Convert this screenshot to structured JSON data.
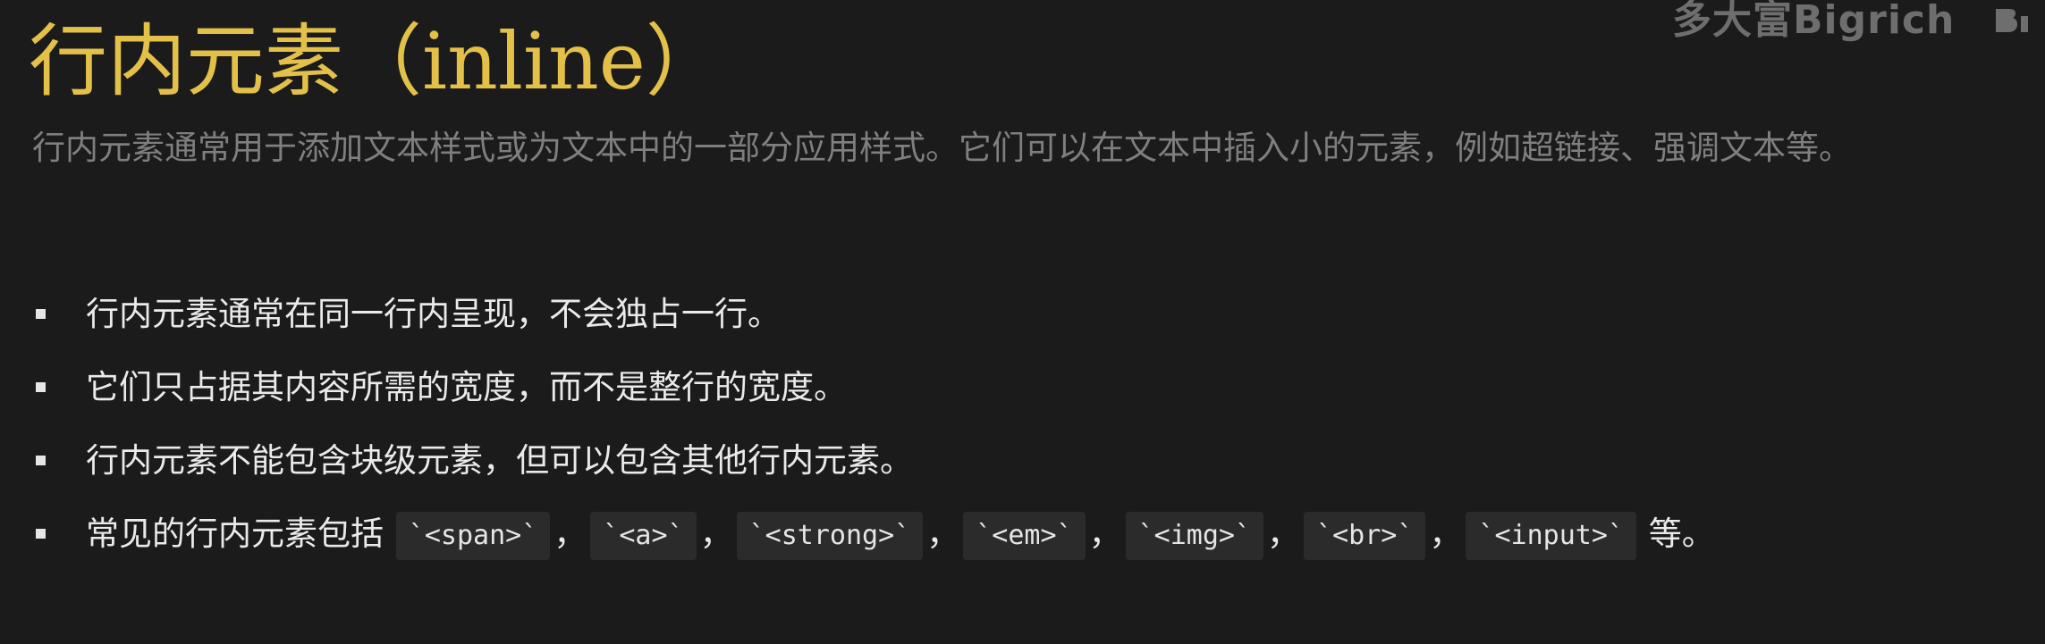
{
  "watermark": {
    "text": "多大富Bigrich",
    "logo_icon": "bilibili-logo-icon"
  },
  "slide": {
    "title": "行内元素（inline）",
    "intro": "行内元素通常用于添加文本样式或为文本中的一部分应用样式。它们可以在文本中插入小的元素，例如超链接、强调文本等。",
    "bullets": [
      "行内元素通常在同一行内呈现，不会独占一行。",
      "它们只占据其内容所需的宽度，而不是整行的宽度。",
      "行内元素不能包含块级元素，但可以包含其他行内元素。"
    ],
    "last_bullet": {
      "prefix": "常见的行内元素包括",
      "codes": [
        "`<span>`",
        "`<a>`",
        "`<strong>`",
        "`<em>`",
        "`<img>`",
        "`<br>`",
        "`<input>`"
      ],
      "separator": "，",
      "suffix": "等。"
    }
  },
  "colors": {
    "background": "#1b1b1b",
    "title": "#e3c048",
    "intro_text": "#7f7f7f",
    "bullet_text": "#eaeaea",
    "code_background": "#2b2b2b"
  }
}
